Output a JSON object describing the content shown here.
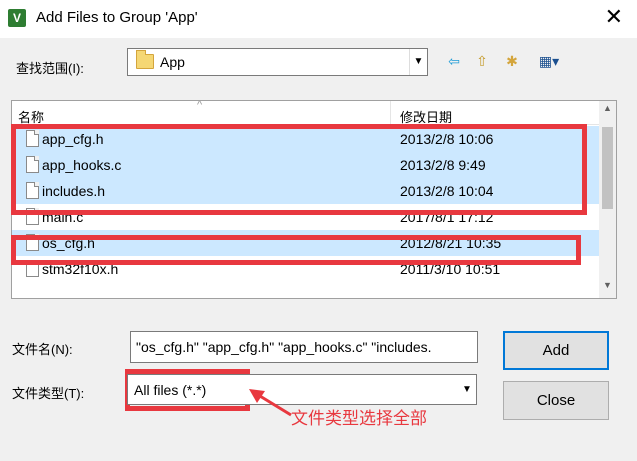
{
  "window": {
    "title": "Add Files to Group 'App'",
    "close_glyph": "✕"
  },
  "lookin": {
    "label": "查找范围(I):",
    "folder": "App",
    "dropdown_glyph": "▼",
    "toolbar": {
      "back_glyph": "⇦",
      "up_glyph": "⇧",
      "new_folder_glyph": "✱",
      "view_menu_glyph": "▦▾"
    }
  },
  "list": {
    "columns": {
      "name": "名称",
      "date": "修改日期"
    },
    "sort_glyph": "^",
    "rows": [
      {
        "name": "app_cfg.h",
        "date": "2013/2/8 10:06",
        "selected": true
      },
      {
        "name": "app_hooks.c",
        "date": "2013/2/8 9:49",
        "selected": true
      },
      {
        "name": "includes.h",
        "date": "2013/2/8 10:04",
        "selected": true
      },
      {
        "name": "main.c",
        "date": "2017/8/1 17:12",
        "selected": false
      },
      {
        "name": "os_cfg.h",
        "date": "2012/8/21 10:35",
        "selected": true
      },
      {
        "name": "stm32f10x.h",
        "date": "2011/3/10 10:51",
        "selected": false
      }
    ],
    "scroll": {
      "up_glyph": "▲",
      "down_glyph": "▼"
    }
  },
  "filename": {
    "label": "文件名(N):",
    "value": "\"os_cfg.h\" \"app_cfg.h\" \"app_hooks.c\" \"includes."
  },
  "filetype": {
    "label": "文件类型(T):",
    "value": "All files (*.*)",
    "dropdown_glyph": "▼"
  },
  "buttons": {
    "add": "Add",
    "close": "Close"
  },
  "annotation": {
    "text": "文件类型选择全部",
    "color": "#e8383f"
  }
}
